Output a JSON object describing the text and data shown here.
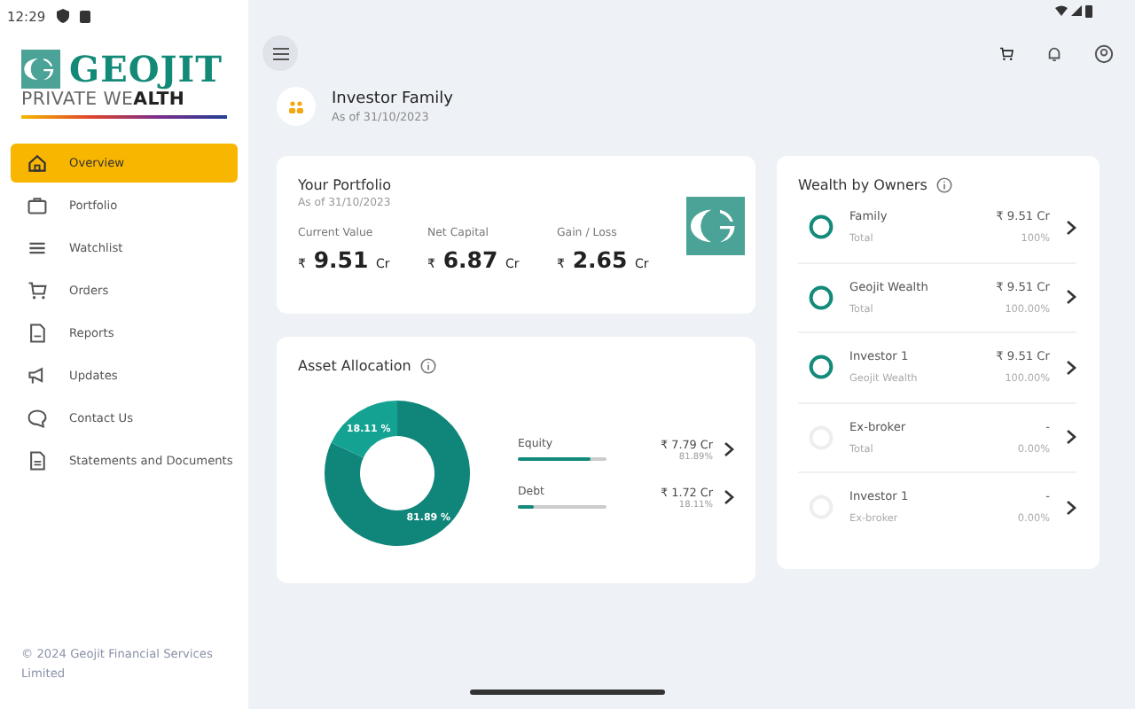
{
  "status_bar": {
    "time": "12:29"
  },
  "logo": {
    "name": "GEOJIT",
    "tagline": "PRIVATE WE**ALTH**"
  },
  "sidebar": {
    "items": [
      {
        "label": "Overview",
        "selected": true
      },
      {
        "label": "Portfolio",
        "selected": false
      },
      {
        "label": "Watchlist",
        "selected": false
      },
      {
        "label": "Orders",
        "selected": false
      },
      {
        "label": "Reports",
        "selected": false
      },
      {
        "label": "Updates",
        "selected": false
      },
      {
        "label": "Contact Us",
        "selected": false
      },
      {
        "label": "Statements and Documents",
        "selected": false
      }
    ],
    "footer": "© 2024 Geojit Financial Services Limited"
  },
  "header": {
    "name": "Investor Family",
    "date": "As of 31/10/2023"
  },
  "portfolio": {
    "title": "Your Portfolio",
    "date": "As of 31/10/2023",
    "metrics": [
      {
        "label": "Current Value",
        "currency": "₹",
        "value": "9.51",
        "unit": "Cr"
      },
      {
        "label": "Net Capital",
        "currency": "₹",
        "value": "6.87",
        "unit": "Cr"
      },
      {
        "label": "Gain / Loss",
        "currency": "₹",
        "value": "2.65",
        "unit": "Cr"
      }
    ]
  },
  "asset_allocation": {
    "title": "Asset Allocation",
    "chart_data": {
      "type": "donut",
      "categories": [
        "Equity",
        "Debt"
      ],
      "values": [
        81.89,
        18.11
      ],
      "value_labels": [
        "81.89 %",
        "18.11 %"
      ]
    },
    "classes": [
      {
        "amount": "₹ 7.79 Cr",
        "percent": "81.89%",
        "level": 0.8189
      },
      {
        "amount": "₹ 1.72 Cr",
        "percent": "18.11%",
        "level": 0.1811
      }
    ]
  },
  "wealth_by_owners": {
    "title": "Wealth by Owners",
    "owners": [
      {
        "name": "Family",
        "group": "Total",
        "amount": "₹ 9.51 Cr",
        "percent": "100%",
        "color": "#148a7a"
      },
      {
        "name": "Geojit Wealth",
        "group": "Total",
        "amount": "₹ 9.51 Cr",
        "percent": "100.00%",
        "color": "#148a7a"
      },
      {
        "name": "Investor 1",
        "group": "Geojit Wealth",
        "amount": "₹ 9.51 Cr",
        "percent": "100.00%",
        "color": "#148a7a"
      },
      {
        "name": "Ex-broker",
        "group": "Total",
        "amount": "-",
        "percent": "0.00%",
        "color": "#eeeeee"
      },
      {
        "name": "Investor 1",
        "group": "Ex-broker",
        "amount": "-",
        "percent": "0.00%",
        "color": "#eeeeee"
      }
    ]
  }
}
